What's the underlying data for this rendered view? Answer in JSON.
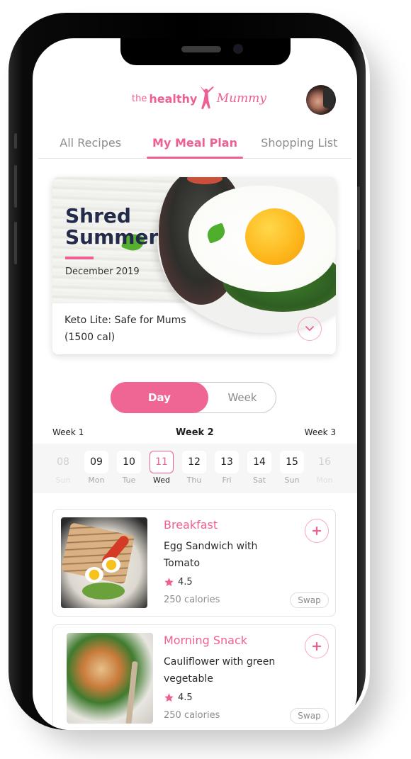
{
  "app": {
    "brand": {
      "prefix": "the",
      "name_bold": "healthy",
      "name_script": "Mummy"
    },
    "colors": {
      "accent": "#ee5f93",
      "title_navy": "#242b4a",
      "muted": "#8d8d8d"
    }
  },
  "header": {
    "avatar_icon": "user-avatar"
  },
  "tabs": [
    {
      "label": "All Recipes",
      "active": false
    },
    {
      "label": "My Meal Plan",
      "active": true
    },
    {
      "label": "Shopping List",
      "active": false
    }
  ],
  "plan": {
    "title_line1": "Shred",
    "title_line2": "Summer",
    "date": "December 2019",
    "name_line1": "Keto Lite: Safe for Mums",
    "name_line2": "(1500 cal)",
    "toggle_icon": "chevron-down-icon"
  },
  "view_toggle": {
    "options": [
      "Day",
      "Week"
    ],
    "selected": "Day"
  },
  "weeks": {
    "prev": "Week 1",
    "current": "Week 2",
    "next": "Week 3"
  },
  "days": [
    {
      "num": "08",
      "label": "Sun",
      "state": "faded"
    },
    {
      "num": "09",
      "label": "Mon",
      "state": "normal"
    },
    {
      "num": "10",
      "label": "Tue",
      "state": "normal"
    },
    {
      "num": "11",
      "label": "Wed",
      "state": "selected"
    },
    {
      "num": "12",
      "label": "Thu",
      "state": "normal"
    },
    {
      "num": "13",
      "label": "Fri",
      "state": "normal"
    },
    {
      "num": "14",
      "label": "Sat",
      "state": "normal"
    },
    {
      "num": "15",
      "label": "Sun",
      "state": "normal"
    },
    {
      "num": "16",
      "label": "Mon",
      "state": "faded"
    }
  ],
  "meals": [
    {
      "type": "Breakfast",
      "name": "Egg Sandwich with Tomato",
      "rating": "4.5",
      "calories": "250 calories",
      "swap_label": "Swap",
      "add_icon": "plus-icon"
    },
    {
      "type": "Morning Snack",
      "name": "Cauliflower with green vegetable",
      "rating": "4.5",
      "calories": "250 calories",
      "swap_label": "Swap",
      "add_icon": "plus-icon"
    }
  ]
}
